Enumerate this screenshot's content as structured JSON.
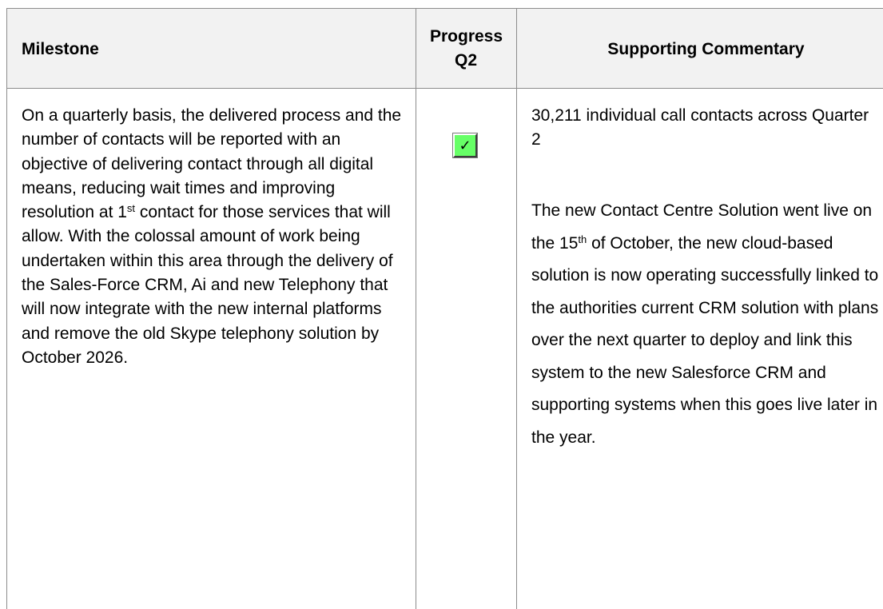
{
  "table": {
    "headers": {
      "milestone": "Milestone",
      "progress": "Progress Q2",
      "commentary": "Supporting Commentary"
    },
    "row": {
      "milestone_before": "On a quarterly basis, the delivered process and the number of contacts will be reported with an objective of delivering contact through all digital means, reducing wait times and improving resolution at 1",
      "milestone_sup": "st",
      "milestone_after": " contact for those services that will allow. With the colossal amount of work being undertaken within this area through the delivery of the Sales-Force CRM, Ai and new Telephony that will now integrate with the new internal platforms and remove the old Skype telephony solution by October 2026.",
      "progress_icon": "checkmark-icon",
      "progress_symbol": "✓",
      "commentary_first": "30,211 individual call contacts across Quarter 2",
      "commentary_second_before": "The new Contact Centre Solution went live on the 15",
      "commentary_second_sup": "th",
      "commentary_second_after": " of October, the new cloud-based solution is now operating successfully linked to the authorities current CRM solution with plans over the next quarter to deploy and link this system to the new Salesforce CRM and supporting systems when this goes live later in the year."
    }
  },
  "colors": {
    "header_background": "#f2f2f2",
    "border": "#8c8c8c",
    "status_complete": "#66ff66"
  }
}
